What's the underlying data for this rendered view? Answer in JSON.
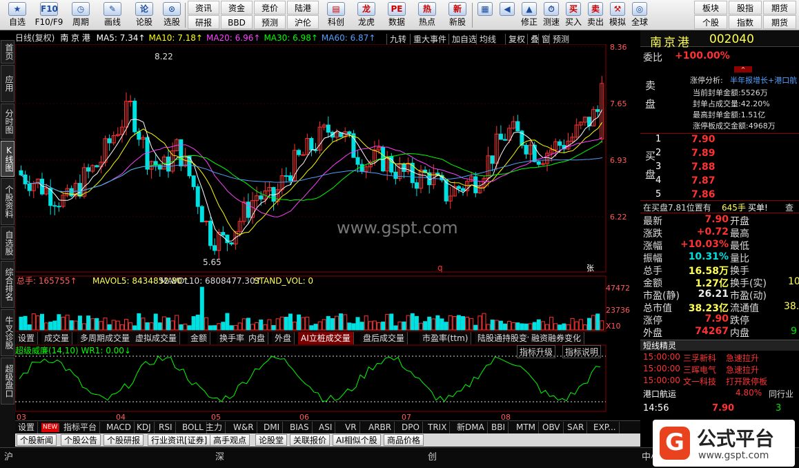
{
  "toolbar": {
    "items": [
      {
        "icon": "★",
        "label": "自选"
      },
      {
        "icon": "F10",
        "label": "F10/F9"
      },
      {
        "icon": "◷",
        "label": "周期"
      },
      {
        "icon": "✎",
        "label": "画线"
      },
      {
        "icon": "论",
        "label": "论股"
      },
      {
        "icon": "⊙",
        "label": "选股"
      }
    ],
    "grid": [
      [
        "资讯",
        "资金",
        "竞价",
        "陆港"
      ],
      [
        "研报",
        "BBD",
        "预测",
        "沪伦"
      ]
    ],
    "items2": [
      {
        "icon": "▤",
        "label": "科创"
      },
      {
        "icon": "龙",
        "label": "龙虎"
      },
      {
        "icon": "PE",
        "label": "数据"
      },
      {
        "icon": "热",
        "label": "热点"
      },
      {
        "icon": "新",
        "label": "新股"
      }
    ],
    "items3": [
      {
        "icon": "▦",
        "label": ""
      },
      {
        "icon": "◀",
        "label": ""
      },
      {
        "icon": "▲",
        "label": "修正"
      },
      {
        "icon": "⏱",
        "label": "测速"
      },
      {
        "icon": "买",
        "label": "买入"
      },
      {
        "icon": "卖",
        "label": "卖出"
      },
      {
        "icon": "⚒",
        "label": "模拟"
      },
      {
        "icon": "◎",
        "label": "全球"
      }
    ],
    "grid2": [
      [
        "板块",
        "股指",
        "期货"
      ],
      [
        "个股",
        "指数",
        "期货"
      ]
    ]
  },
  "leftnav": [
    "首页",
    "应用",
    "分时图",
    "K线图",
    "个股资料",
    "自选股",
    "综合排名",
    "牛叉诊股",
    "超级盘口"
  ],
  "chart": {
    "title": "日线(复权)",
    "stock": "南 京 港",
    "ma": [
      {
        "k": "MA5: 7.34↑",
        "c": "#ffffff"
      },
      {
        "k": "MA10: 7.18↑",
        "c": "#ffff00"
      },
      {
        "k": "MA20: 6.96↑",
        "c": "#ff40ff"
      },
      {
        "k": "MA30: 6.98↑",
        "c": "#00ff00"
      },
      {
        "k": "MA60: 6.87↑",
        "c": "#50a0ff"
      }
    ],
    "tabs": [
      "九转",
      "重大事件",
      "加自选",
      "均线",
      "复权",
      "叠",
      "窗",
      "预测"
    ],
    "price_axis": [
      "8.36",
      "7.65",
      "6.93",
      "6.22"
    ],
    "high": "8.22",
    "low": "5.65",
    "q": "q",
    "zhang": "张",
    "watermark": "www.gspt.com"
  },
  "volume": {
    "label": "总手: 165755↑",
    "mavol5": "MAVOL5: 8434852.80↑",
    "mavol10": "MAVOL10: 6808477.30↑",
    "stand": "STAND_VOL: 0",
    "axis": [
      "47472",
      "23736"
    ],
    "x10": "X10"
  },
  "vol_tabs": [
    "设置",
    "成交量",
    "多周期成交量",
    "虚拟成交量",
    "金额",
    "换手率",
    "内盘",
    "外盘",
    "AI立桩成交量",
    "盘后成交量",
    "市盈率(ttm)",
    "陆股通持股变化",
    "融资融券变化"
  ],
  "wr": {
    "label": "超级威廉(14,10) WR1: 0.00↓",
    "btn1": "指标升级",
    "btn2": "指标说明",
    "months": [
      "03",
      "04",
      "05",
      "06",
      "07",
      "08"
    ]
  },
  "ind_tabs": [
    "设置",
    "NEW",
    "指标平台",
    "MACD",
    "KDJ",
    "RSI",
    "BOLL",
    "主力",
    "W&R",
    "DMI",
    "BIAS",
    "ASI",
    "VR",
    "ARBR",
    "DPO",
    "TRIX",
    "新DMA",
    "BBI",
    "MTM",
    "OBV",
    "SAR",
    "EXP..."
  ],
  "news_tabs": [
    "个股新闻",
    "个股公告",
    "个股研报",
    "行业资讯[证券]",
    "高手观点",
    "论股堂",
    "关联报价",
    "AI相似个股",
    "商品价格"
  ],
  "right": {
    "name": "南京港",
    "code": "002040",
    "weibi_l": "委比",
    "weibi": "+100.00%",
    "zt": {
      "t": "涨停分析:",
      "v": "半年报增长+港口航",
      "lines": [
        "当前封单金额:5526万",
        "封单占成交量:42.20%",
        "最高封单金额:1.51亿",
        "涨停板成交金额:4968万"
      ]
    },
    "sell_label": "卖盘",
    "buy_label": "买盘",
    "buys": [
      {
        "n": "1",
        "p": "7.90"
      },
      {
        "n": "2",
        "p": "7.89"
      },
      {
        "n": "3",
        "p": "7.88"
      },
      {
        "n": "4",
        "p": "7.87"
      },
      {
        "n": "5",
        "p": "7.86"
      }
    ],
    "zaimai": "在买盘7.81位置有",
    "zaimai_v": "645手",
    "zaimai_t": "买单!",
    "cha": "查",
    "stats": [
      {
        "a": "最新",
        "av": "7.90",
        "b": "开盘",
        "ac": "red"
      },
      {
        "a": "涨跌",
        "av": "+0.72",
        "b": "最高",
        "ac": "red"
      },
      {
        "a": "涨幅",
        "av": "+10.03%",
        "b": "最低",
        "ac": "red"
      },
      {
        "a": "振幅",
        "av": "10.31%",
        "b": "量比",
        "ac": "cyn"
      },
      {
        "a": "总手",
        "av": "16.58万",
        "b": "换手",
        "ac": "yel"
      },
      {
        "a": "金额",
        "av": "1.27亿",
        "b": "换手(实)",
        "ac": "yel"
      },
      {
        "a": "市盈(静)",
        "av": "26.21",
        "b": "市盈(动)",
        "ac": "wht"
      },
      {
        "a": "总市值",
        "av": "38.23亿",
        "b": "流通值",
        "ac": "yel"
      },
      {
        "a": "涨停",
        "av": "7.90",
        "b": "跌停",
        "ac": "red"
      },
      {
        "a": "外盘",
        "av": "74267",
        "b": "内盘",
        "ac": "red"
      }
    ],
    "right_vals": [
      "10",
      "38.",
      "9"
    ],
    "dxjl": "短线精灵",
    "alerts": [
      {
        "t": "15:00:00",
        "s": "三孚新科",
        "e": "急速拉升"
      },
      {
        "t": "15:00:00",
        "s": "三晖电气",
        "e": "急速拉升"
      },
      {
        "t": "15:00:00",
        "s": "文一科技",
        "e": "打开跌停板"
      }
    ],
    "gkhy": "港口航运",
    "gkhy_v": "4.80%",
    "tonghang": "同行业",
    "tick": {
      "t": "14:56",
      "p": "7.90",
      "v": "3"
    }
  },
  "status": {
    "sh": "沪",
    "sz": "深",
    "cy": "创",
    "zx": "中小"
  },
  "logo": {
    "name": "公式平台",
    "url": "www.gspt.com"
  },
  "colors": {
    "up": "#ff3232",
    "down": "#00e0e0",
    "bg": "#000000"
  }
}
